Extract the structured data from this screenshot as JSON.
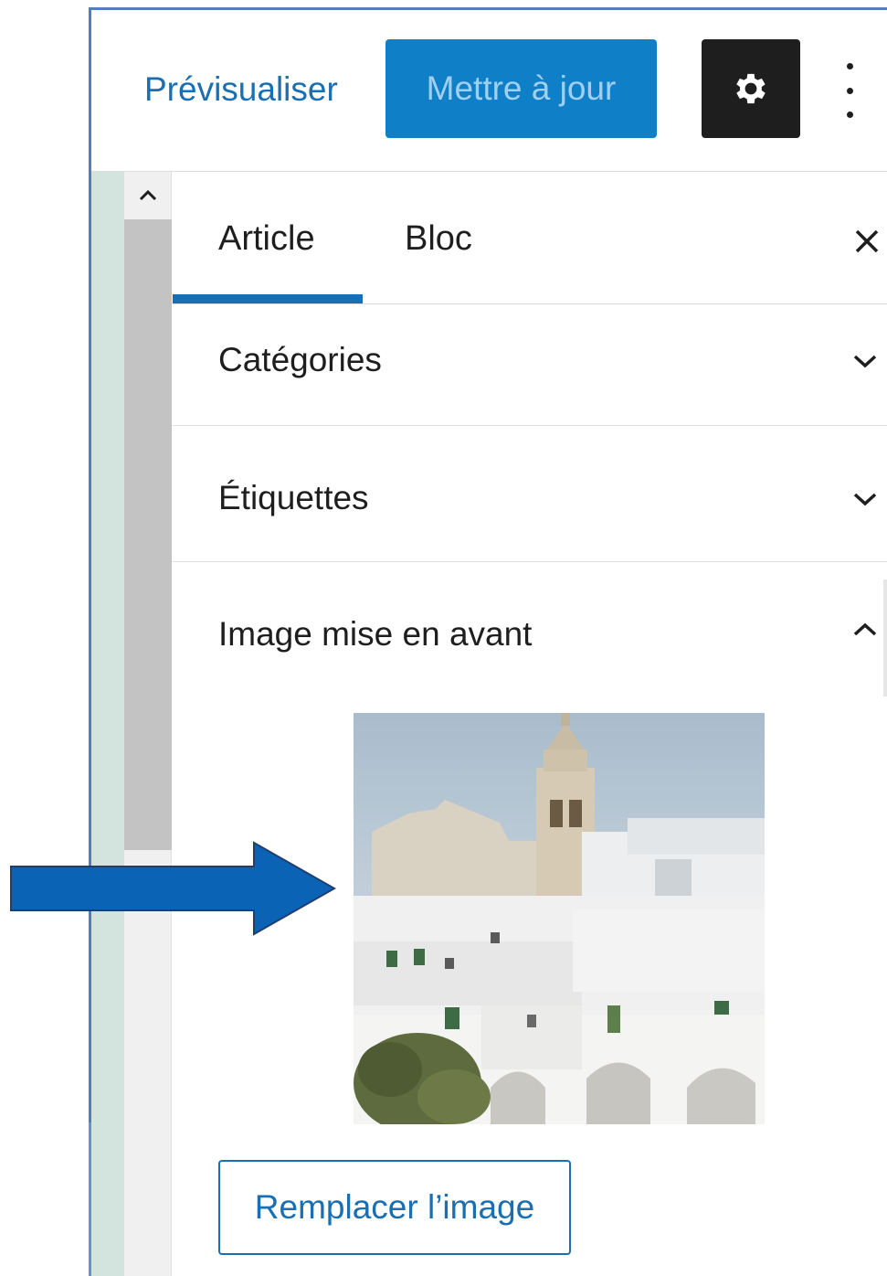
{
  "header": {
    "preview_label": "Prévisualiser",
    "update_label": "Mettre à jour",
    "settings_icon": "gear-icon",
    "more_icon": "vertical-ellipsis-icon"
  },
  "tabs": {
    "items": [
      {
        "label": "Article",
        "active": true
      },
      {
        "label": "Bloc",
        "active": false
      }
    ],
    "close_icon": "close-icon"
  },
  "sections": {
    "categories": {
      "title": "Catégories",
      "expanded": false,
      "icon": "chevron-down-icon"
    },
    "tags": {
      "title": "Étiquettes",
      "expanded": false,
      "icon": "chevron-down-icon"
    },
    "featured_image": {
      "title": "Image mise en avant",
      "expanded": true,
      "icon": "chevron-up-icon",
      "image_subject": "white hillside town with bell tower",
      "replace_label": "Remplacer l’image"
    }
  },
  "annotation": {
    "icon": "arrow-right-icon",
    "color": "#0b63b6"
  },
  "colors": {
    "accent": "#0f7fc7",
    "link": "#1a6fb3",
    "dark_button": "#1e1e1e"
  }
}
